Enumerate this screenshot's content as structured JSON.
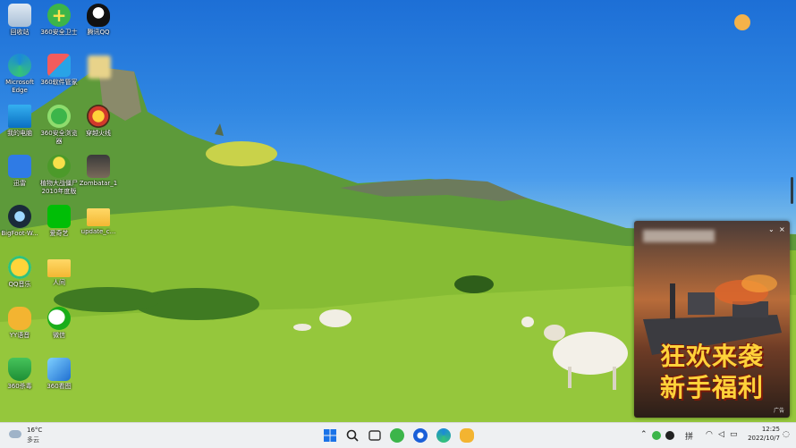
{
  "desktop_icons": [
    {
      "label": "回收站",
      "icon": "recycle-bin-icon"
    },
    {
      "label": "360安全卫士",
      "icon": "360-safe-icon"
    },
    {
      "label": "腾讯QQ",
      "icon": "qq-penguin-icon"
    },
    {
      "label": "Microsoft\nEdge",
      "icon": "edge-icon"
    },
    {
      "label": "360软件管家",
      "icon": "360-software-icon"
    },
    {
      "label": "我的电脑",
      "icon": "computer-icon"
    },
    {
      "label": "360安全浏览\n器",
      "icon": "360-browser-icon"
    },
    {
      "label": "穿越火线",
      "icon": "crossfire-icon"
    },
    {
      "label": "迅雷",
      "icon": "xunlei-bird-icon"
    },
    {
      "label": "植物大战僵尸\n2010年度版",
      "icon": "plants-vs-zombies-icon"
    },
    {
      "label": "Zombatar_1",
      "icon": "zombatar-icon"
    },
    {
      "label": "BigFoot-W...",
      "icon": "bigfoot-icon"
    },
    {
      "label": "爱奇艺",
      "icon": "iqiyi-icon"
    },
    {
      "label": "update_c...",
      "icon": "folder-icon"
    },
    {
      "label": "QQ音乐",
      "icon": "qq-music-icon"
    },
    {
      "label": "人间",
      "icon": "folder-icon"
    },
    {
      "label": "YY语音",
      "icon": "yy-voice-icon"
    },
    {
      "label": "微信",
      "icon": "wechat-icon"
    },
    {
      "label": "360杀毒",
      "icon": "360-antivirus-icon"
    },
    {
      "label": "360看图",
      "icon": "360-image-viewer-icon"
    }
  ],
  "ad": {
    "slogan_line1": "狂欢来袭",
    "slogan_line2": "新手福利",
    "chevron": "⌄",
    "close": "×",
    "tag": "广告"
  },
  "taskbar": {
    "weather_temp": "16°C",
    "weather_desc": "多云",
    "input_lang": "拼",
    "clock_time": "12:25",
    "clock_date": "2022/10/7",
    "tray_chevron": "⌃"
  },
  "colors": {
    "taskbar_bg": "#eef0f2",
    "start_blue": "#1a73e8",
    "ad_slogan": "#ffd23a"
  }
}
